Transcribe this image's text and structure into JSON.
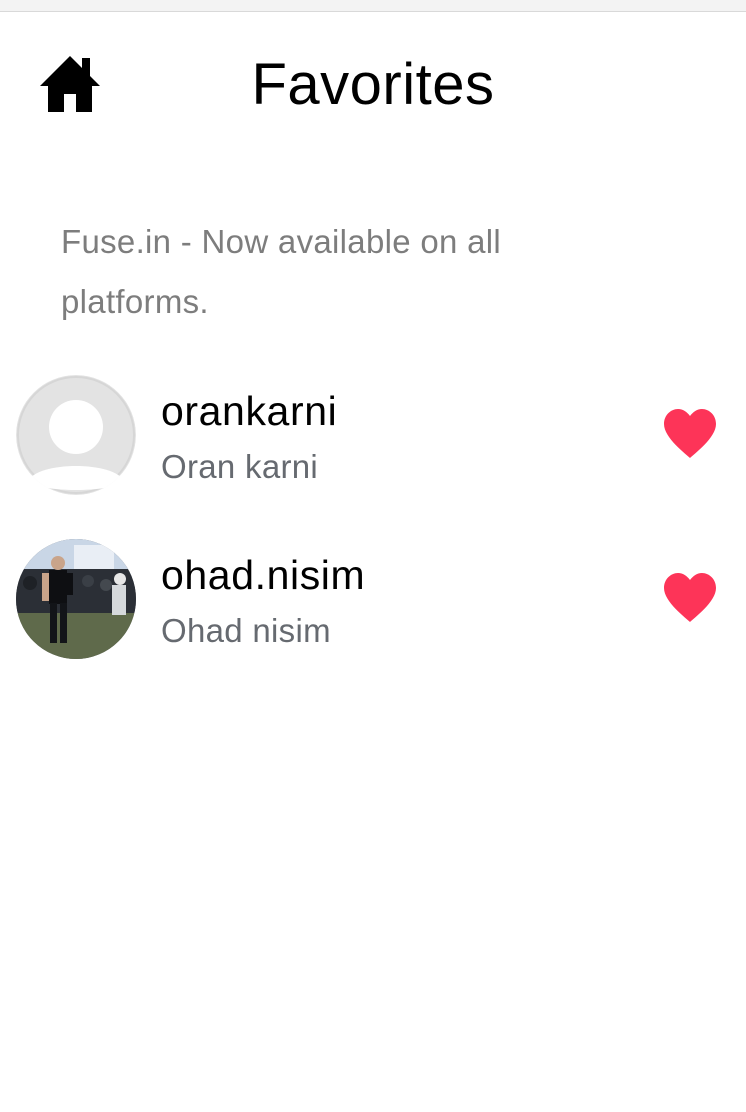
{
  "header": {
    "title": "Favorites",
    "home_icon": "home-icon"
  },
  "banner": {
    "text": "Fuse.in - Now available on all platforms."
  },
  "favorites": [
    {
      "username": "orankarni",
      "full_name": "Oran karni",
      "avatar": "default-avatar-icon",
      "favorited": true
    },
    {
      "username": "ohad.nisim",
      "full_name": "Ohad nisim",
      "avatar": "user-photo",
      "favorited": true
    }
  ],
  "colors": {
    "heart": "#fd3458",
    "title": "#000000",
    "banner_text": "#7d7d7d",
    "subtitle_text": "#666a70",
    "avatar_placeholder": "#e3e3e3"
  }
}
